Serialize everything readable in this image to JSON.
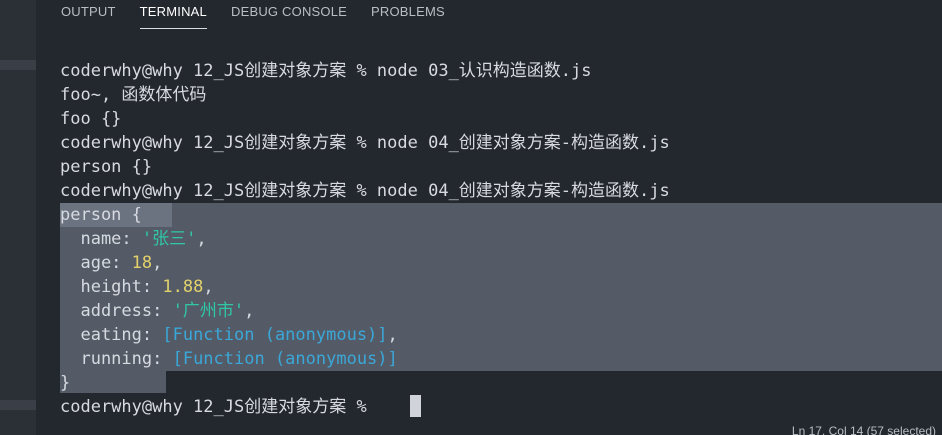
{
  "tabs": [
    {
      "label": "OUTPUT",
      "active": false
    },
    {
      "label": "TERMINAL",
      "active": true
    },
    {
      "label": "DEBUG CONSOLE",
      "active": false
    },
    {
      "label": "PROBLEMS",
      "active": false
    }
  ],
  "terminal": {
    "cmd1": "coderwhy@why 12_JS创建对象方案 % node 03_认识构造函数.js",
    "out1": "foo~, 函数体代码",
    "out2": "foo {}",
    "cmd2": "coderwhy@why 12_JS创建对象方案 % node 04_创建对象方案-构造函数.js",
    "out3": "person {}",
    "cmd3": "coderwhy@why 12_JS创建对象方案 % node 04_创建对象方案-构造函数.js",
    "obj_open": "person {",
    "fields": {
      "name_key": "  name: ",
      "name_val": "'张三'",
      "age_key": "  age: ",
      "age_val": "18",
      "height_key": "  height: ",
      "height_val": "1.88",
      "address_key": "  address: ",
      "address_val": "'广州市'",
      "eating_key": "  eating: ",
      "eating_val": "[Function (anonymous)]",
      "running_key": "  running: ",
      "running_val": "[Function (anonymous)]"
    },
    "obj_close": "}",
    "prompt": "coderwhy@why 12_JS创建对象方案 % "
  },
  "status": {
    "position": "Ln 17, Col 14 (57 selected)"
  },
  "colors": {
    "background": "#23272e",
    "string": "#2fc7a6",
    "number": "#e3d26b",
    "function": "#3ba7d8",
    "selection": "#7e8796"
  }
}
